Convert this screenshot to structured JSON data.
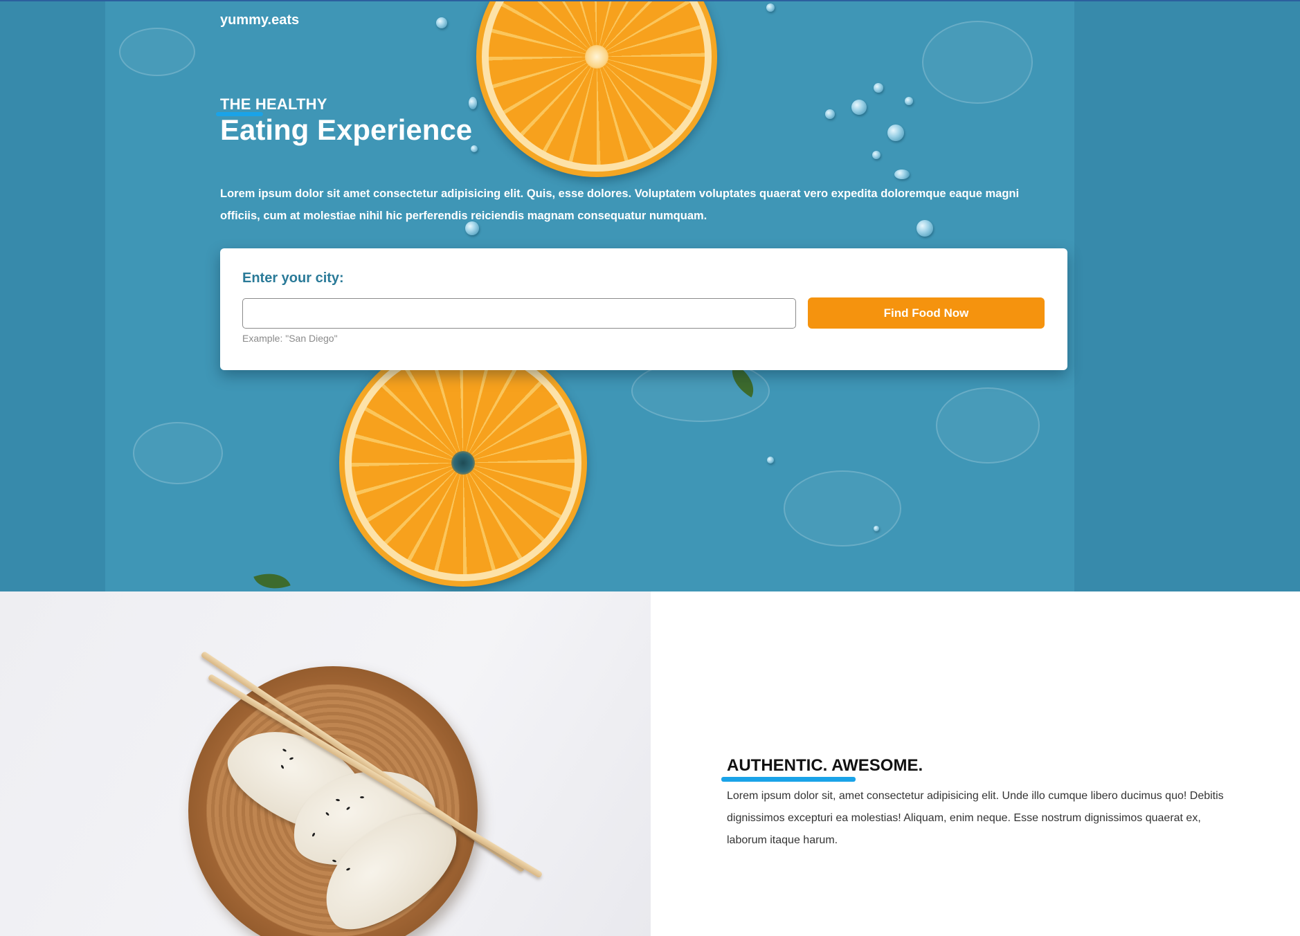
{
  "brand": {
    "logo": "yummy.eats"
  },
  "hero": {
    "kicker": "THE HEALTHY",
    "title": "Eating Experience",
    "description": "Lorem ipsum dolor sit amet consectetur adipisicing elit. Quis, esse dolores. Voluptatem voluptates quaerat vero expedita doloremque eaque magni officiis, cum at molestiae nihil hic perferendis reiciendis magnam consequatur numquam."
  },
  "search": {
    "label": "Enter your city:",
    "value": "",
    "placeholder": "",
    "example": "Example: \"San Diego\"",
    "button_label": "Find Food Now"
  },
  "feature": {
    "heading": "AUTHENTIC. AWESOME.",
    "body": "Lorem ipsum dolor sit, amet consectetur adipisicing elit. Unde illo cumque libero ducimus quo! Debitis dignissimos excepturi ea molestias! Aliquam, enim neque. Esse nostrum dignissimos quaerat ex, laborum itaque harum."
  },
  "colors": {
    "hero_bg": "#3f96b6",
    "accent_orange": "#f5930e",
    "accent_blue": "#1aa3e8",
    "label_teal": "#2a7a98"
  },
  "icons": {
    "hero_image": "orange-slices-on-water-photo",
    "feature_image": "dumplings-on-wooden-plate-photo"
  }
}
